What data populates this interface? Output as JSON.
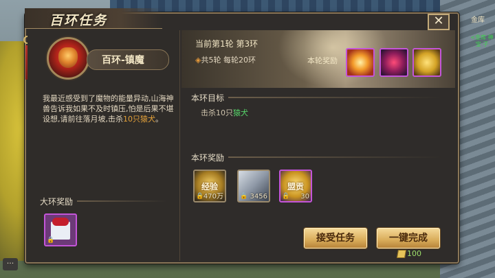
{
  "window": {
    "title": "百环任务",
    "close_symbol": "✕"
  },
  "top_right": {
    "label": "金库"
  },
  "side_note": {
    "text": "<金库 神 宝 子"
  },
  "left": {
    "task_name": "百环-镇魔",
    "description_before": "我最近感受到了魔物的能量异动,山海神兽告诉我如果不及时镇压,怕是后果不堪设想,请前往落月坡,击杀",
    "description_highlight": "10只猿犬",
    "description_after": "。",
    "big_reward_label": "大环奖励"
  },
  "right": {
    "round_status": "当前第1轮 第3环",
    "round_info": "共5轮 每轮20环",
    "round_reward_label": "本轮奖励",
    "target_label": "本环目标",
    "target_prefix": "击杀10只",
    "target_monster": "猿犬",
    "ring_reward_label": "本环奖励",
    "rewards": [
      {
        "name": "经验",
        "qty": "470万",
        "icon": "exp-icon"
      },
      {
        "name": "",
        "qty": "3456",
        "icon": "scroll-icon"
      },
      {
        "name": "盟贡",
        "qty": "30",
        "icon": "contrib-icon"
      }
    ],
    "round_rewards": [
      {
        "icon": "fire-orb-icon"
      },
      {
        "icon": "purple-orb-icon"
      },
      {
        "icon": "gold-bar-icon"
      }
    ]
  },
  "buttons": {
    "accept": "接受任务",
    "complete": "一键完成"
  },
  "cost": {
    "amount": "100",
    "icon": "gold-ingot-icon"
  },
  "colors": {
    "accent": "#e6a33b",
    "green": "#57d66a",
    "purple_border": "#c455d9"
  }
}
